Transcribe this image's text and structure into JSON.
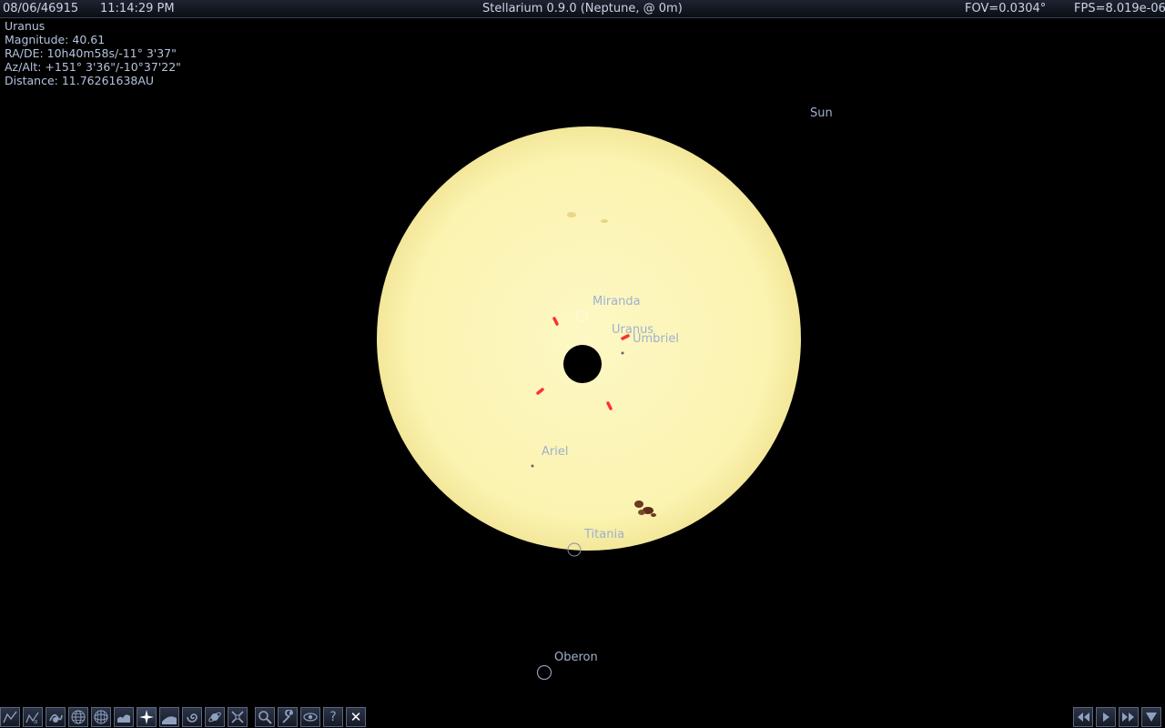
{
  "topbar": {
    "date": "08/06/46915",
    "time": "11:14:29 PM",
    "title": "Stellarium 0.9.0 (Neptune,  @ 0m)",
    "fov": "FOV=0.0304°",
    "fps": "FPS=8.019e-06"
  },
  "info": {
    "name": "Uranus",
    "magnitude": "Magnitude: 40.61",
    "radec": "RA/DE: 10h40m58s/-11° 3'37\"",
    "azalt": "Az/Alt: +151° 3'36\"/-10°37'22\"",
    "distance": "Distance: 11.76261638AU"
  },
  "labels": {
    "sun": "Sun",
    "miranda": "Miranda",
    "uranus": "Uranus",
    "umbriel": "Umbriel",
    "ariel": "Ariel",
    "titania": "Titania",
    "oberon": "Oberon"
  },
  "colors": {
    "sun_fill": "#fbf4b4",
    "label": "#9fb0cc",
    "pointer": "#ff3030"
  },
  "toolbar": {
    "left_icons": [
      "constellation-lines-icon",
      "constellation-names-icon",
      "constellation-art-icon",
      "equatorial-grid-icon",
      "azimuthal-grid-icon",
      "ground-icon",
      "cardinal-points-icon",
      "atmosphere-icon",
      "nebulas-icon",
      "planet-labels-icon",
      "mount-icon",
      "search-icon",
      "configuration-icon",
      "night-mode-icon",
      "help-icon",
      "quit-icon"
    ],
    "help_label": "?",
    "quit_label": "✕",
    "right_icons": [
      "rewind-icon",
      "play-icon",
      "fast-forward-icon",
      "real-time-icon"
    ]
  }
}
